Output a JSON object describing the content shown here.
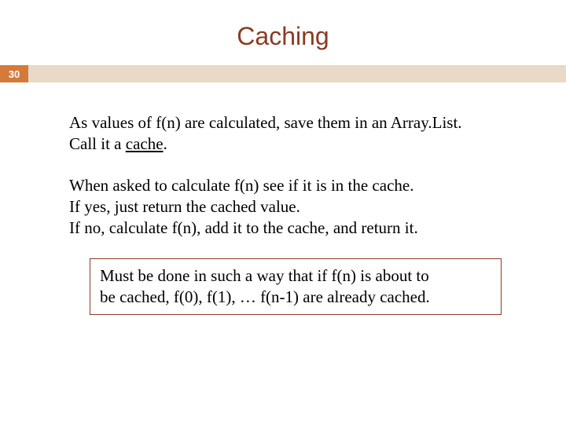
{
  "title": "Caching",
  "page_number": "30",
  "para1_line1": "As values of f(n) are calculated, save them in an Array.List.",
  "para1_line2a": "Call it a ",
  "para1_cache": "cache",
  "para1_line2b": ".",
  "para2_line1": "When asked to calculate f(n) see if it is in the cache.",
  "para2_line2": "If yes, just return the cached value.",
  "para2_line3": "If no, calculate f(n), add it to the cache, and return it.",
  "callout_line1": "Must be done in such a way that if f(n) is about to",
  "callout_line2": "be cached, f(0), f(1), … f(n-1) are already cached."
}
